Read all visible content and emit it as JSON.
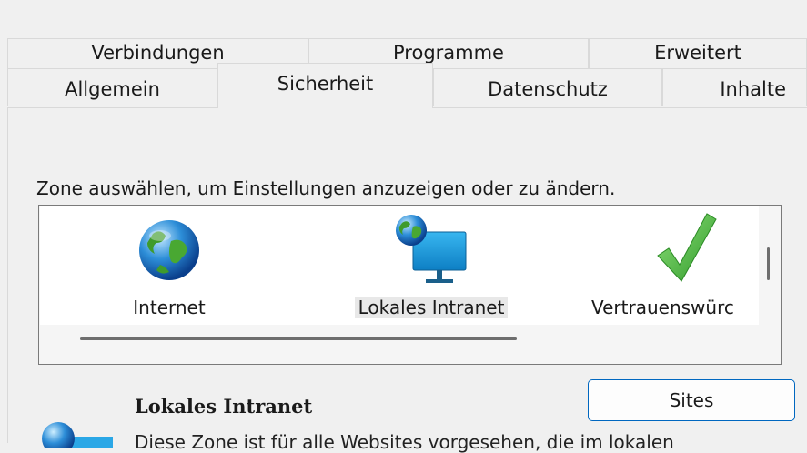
{
  "tabs_row_back": [
    {
      "label": "Verbindungen"
    },
    {
      "label": "Programme"
    },
    {
      "label": "Erweitert"
    }
  ],
  "tabs_row_front": [
    {
      "label": "Allgemein"
    },
    {
      "label": "Sicherheit",
      "selected": true
    },
    {
      "label": "Datenschutz"
    },
    {
      "label": "Inhalte"
    }
  ],
  "zone_prompt": "Zone auswählen, um Einstellungen anzuzeigen oder zu ändern.",
  "zones": [
    {
      "label": "Internet",
      "icon": "globe-icon"
    },
    {
      "label": "Lokales Intranet",
      "icon": "intranet-monitor-icon",
      "selected": true
    },
    {
      "label": "Vertrauenswürc",
      "icon": "checkmark-icon"
    }
  ],
  "selected_zone": {
    "title": "Lokales Intranet",
    "sites_button": "Sites",
    "description": "Diese Zone ist für alle Websites vorgesehen, die im lokalen"
  },
  "colors": {
    "window_bg": "#f0f0f0",
    "accent": "#0067c0",
    "border": "#d9d9d9"
  }
}
